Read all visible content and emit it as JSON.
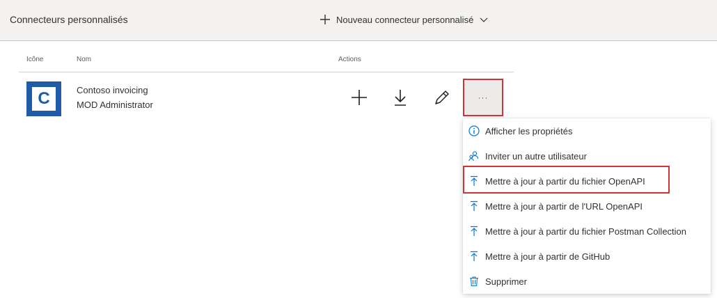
{
  "header": {
    "title": "Connecteurs personnalisés",
    "new_connector_label": "Nouveau connecteur personnalisé"
  },
  "table": {
    "columns": [
      "Icône",
      "Nom",
      "Actions"
    ],
    "rows": [
      {
        "icon_letter": "C",
        "name": "Contoso invoicing",
        "owner": "MOD Administrator"
      }
    ]
  },
  "actions": {
    "more_label": "···"
  },
  "menu": {
    "items": [
      {
        "label": "Afficher les propriétés",
        "icon": "info-icon"
      },
      {
        "label": "Inviter un autre utilisateur",
        "icon": "invite-user-icon"
      },
      {
        "label": "Mettre à jour à partir du fichier OpenAPI",
        "icon": "upload-icon"
      },
      {
        "label": "Mettre à jour à partir de l'URL OpenAPI",
        "icon": "upload-icon"
      },
      {
        "label": "Mettre à jour à partir du fichier Postman Collection",
        "icon": "upload-icon"
      },
      {
        "label": "Mettre à jour à partir de GitHub",
        "icon": "upload-icon"
      },
      {
        "label": "Supprimer",
        "icon": "trash-icon"
      }
    ]
  },
  "colors": {
    "accent": "#0078d4",
    "highlight_border": "#d13438",
    "connector_icon_bg": "#1f5ba8"
  }
}
